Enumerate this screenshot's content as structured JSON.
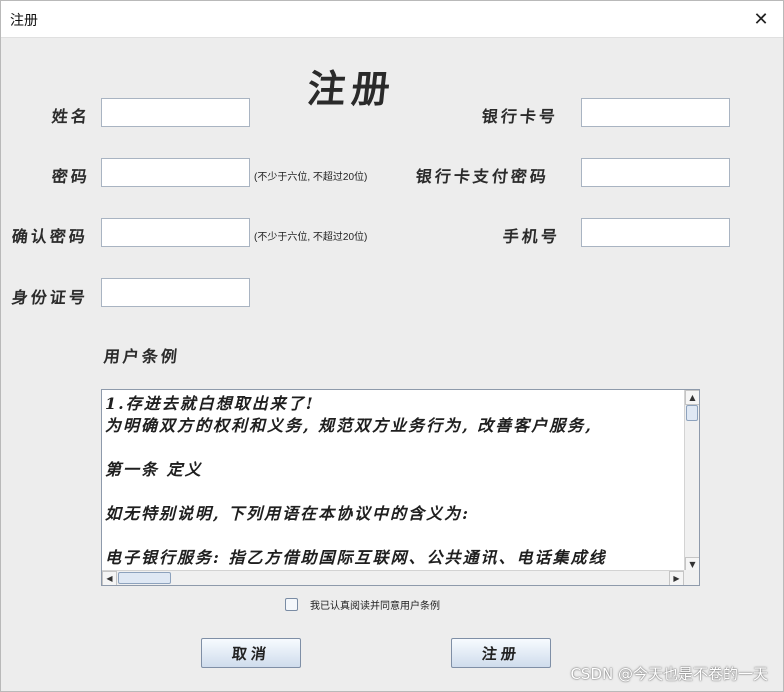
{
  "window": {
    "title": "注册",
    "close_glyph": "✕"
  },
  "heading": "注册",
  "form": {
    "name_label": "姓名",
    "password_label": "密码",
    "password_hint": "(不少于六位, 不超过20位)",
    "confirm_label": "确认密码",
    "confirm_hint": "(不少于六位, 不超过20位)",
    "id_label": "身份证号",
    "card_label": "银行卡号",
    "pay_password_label": "银行卡支付密码",
    "phone_label": "手机号",
    "values": {
      "name": "",
      "password": "",
      "confirm": "",
      "id": "",
      "card": "",
      "pay_password": "",
      "phone": ""
    }
  },
  "terms": {
    "title": "用户条例",
    "lines": [
      "1.存进去就白想取出来了!",
      "为明确双方的权利和义务, 规范双方业务行为, 改善客户服务, ",
      "",
      "第一条 定义",
      "",
      "如无特别说明, 下列用语在本协议中的含义为:",
      "",
      "电子银行服务: 指乙方借助国际互联网、公共通讯、电话集成线"
    ]
  },
  "agree_label": "我已认真阅读并同意用户条例",
  "buttons": {
    "cancel": "取消",
    "register": "注册"
  },
  "watermark": "CSDN @今天也是不卷的一天",
  "icons": {
    "close": "close-icon",
    "scroll_up": "arrow-up-icon",
    "scroll_down": "arrow-down-icon",
    "scroll_left": "arrow-left-icon",
    "scroll_right": "arrow-right-icon"
  }
}
